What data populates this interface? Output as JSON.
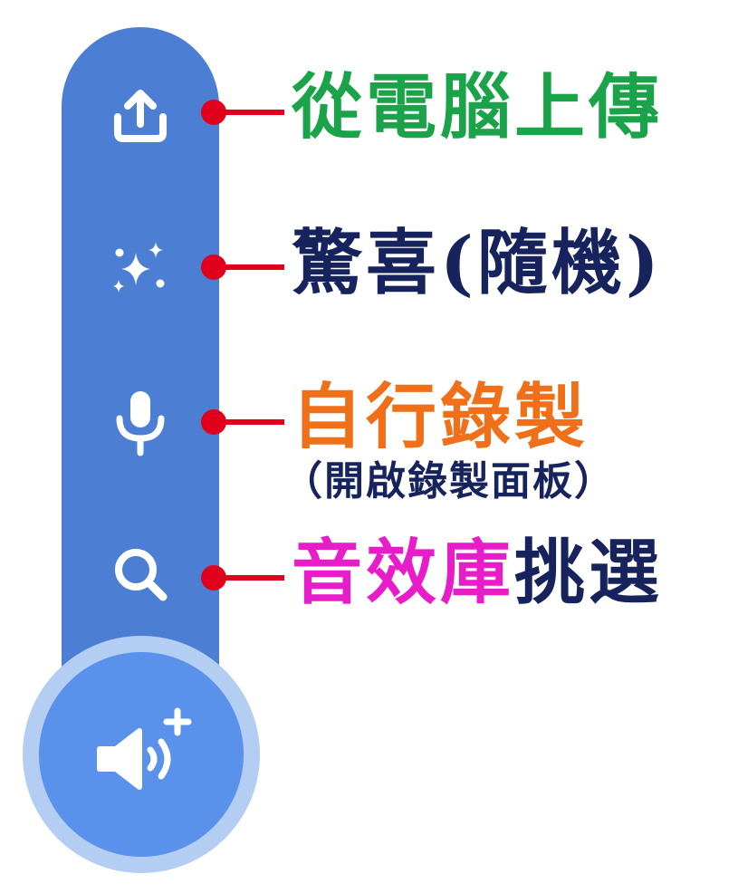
{
  "menu": {
    "items": [
      {
        "icon": "upload-icon"
      },
      {
        "icon": "sparkles-icon"
      },
      {
        "icon": "microphone-icon"
      },
      {
        "icon": "search-icon"
      }
    ],
    "fab_icon": "sound-add-icon",
    "colors": {
      "bar": "#4c7fd4",
      "fab": "#5a92eb",
      "fab_glow": "#b4cdf3",
      "icon": "#ffffff"
    }
  },
  "callouts": {
    "upload": {
      "text": "從電腦上傳",
      "color": "#1ba34a"
    },
    "surprise": {
      "text": "驚喜(隨機)",
      "color": "#16235c"
    },
    "record": {
      "text": "自行錄製",
      "color": "#f07019"
    },
    "record_sub": {
      "text": "（開啟錄製面板）",
      "color": "#16235c"
    },
    "choose": {
      "highlight": "音效庫",
      "highlight_color": "#e81cc8",
      "rest": "挑選",
      "rest_color": "#16235c"
    },
    "pointer_color": "#e0001b"
  }
}
